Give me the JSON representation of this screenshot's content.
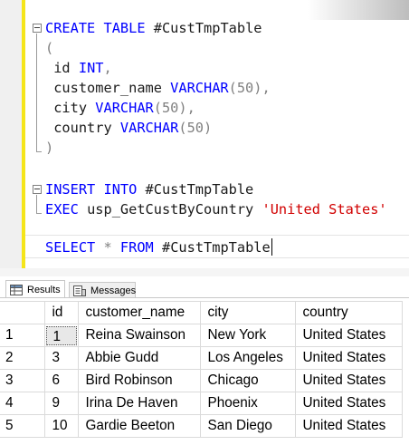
{
  "editor": {
    "line1": {
      "kw1": "CREATE",
      "kw2": "TABLE",
      "name": "#CustTmpTable"
    },
    "line2": "(",
    "line3": {
      "name": "id",
      "type": "INT",
      "punct": ","
    },
    "line4": {
      "name": "customer_name",
      "type": "VARCHAR",
      "size": "(50)",
      "punct": ","
    },
    "line5": {
      "name": "city",
      "type": "VARCHAR",
      "size": "(50)",
      "punct": ","
    },
    "line6": {
      "name": "country",
      "type": "VARCHAR",
      "size": "(50)"
    },
    "line7": ")",
    "line8": {
      "kw1": "INSERT",
      "kw2": "INTO",
      "name": "#CustTmpTable"
    },
    "line9": {
      "kw": "EXEC",
      "proc": "usp_GetCustByCountry",
      "arg": "'United States'"
    },
    "line10": {
      "kw1": "SELECT",
      "star": "*",
      "kw2": "FROM",
      "name": "#CustTmpTable"
    }
  },
  "tabs": [
    {
      "label": "Results",
      "icon": "grid-icon",
      "selected": true
    },
    {
      "label": "Messages",
      "icon": "messages-icon",
      "selected": false
    }
  ],
  "grid": {
    "columns": [
      "id",
      "customer_name",
      "city",
      "country"
    ],
    "rows": [
      {
        "rownum": "1",
        "id": "1",
        "customer_name": "Reina Swainson",
        "city": "New York",
        "country": "United States"
      },
      {
        "rownum": "2",
        "id": "3",
        "customer_name": "Abbie Gudd",
        "city": "Los Angeles",
        "country": "United States"
      },
      {
        "rownum": "3",
        "id": "6",
        "customer_name": "Bird Robinson",
        "city": "Chicago",
        "country": "United States"
      },
      {
        "rownum": "4",
        "id": "9",
        "customer_name": "Irina De Haven",
        "city": "Phoenix",
        "country": "United States"
      },
      {
        "rownum": "5",
        "id": "10",
        "customer_name": "Gardie Beeton",
        "city": "San Diego",
        "country": "United States"
      }
    ]
  },
  "colors": {
    "keyword": "#0000ff",
    "string": "#d10000",
    "change_bar": "#f5e51a"
  }
}
